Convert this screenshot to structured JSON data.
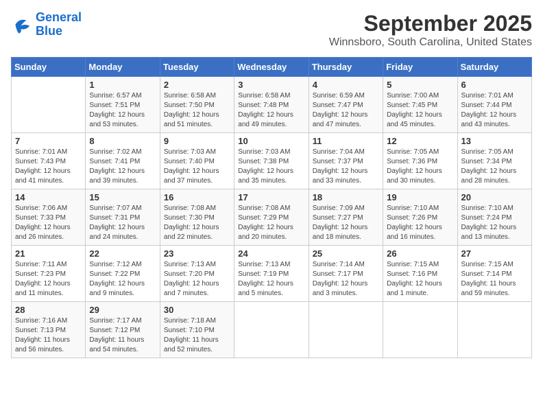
{
  "logo": {
    "line1": "General",
    "line2": "Blue"
  },
  "title": "September 2025",
  "location": "Winnsboro, South Carolina, United States",
  "days_of_week": [
    "Sunday",
    "Monday",
    "Tuesday",
    "Wednesday",
    "Thursday",
    "Friday",
    "Saturday"
  ],
  "weeks": [
    [
      {
        "day": "",
        "info": ""
      },
      {
        "day": "1",
        "info": "Sunrise: 6:57 AM\nSunset: 7:51 PM\nDaylight: 12 hours\nand 53 minutes."
      },
      {
        "day": "2",
        "info": "Sunrise: 6:58 AM\nSunset: 7:50 PM\nDaylight: 12 hours\nand 51 minutes."
      },
      {
        "day": "3",
        "info": "Sunrise: 6:58 AM\nSunset: 7:48 PM\nDaylight: 12 hours\nand 49 minutes."
      },
      {
        "day": "4",
        "info": "Sunrise: 6:59 AM\nSunset: 7:47 PM\nDaylight: 12 hours\nand 47 minutes."
      },
      {
        "day": "5",
        "info": "Sunrise: 7:00 AM\nSunset: 7:45 PM\nDaylight: 12 hours\nand 45 minutes."
      },
      {
        "day": "6",
        "info": "Sunrise: 7:01 AM\nSunset: 7:44 PM\nDaylight: 12 hours\nand 43 minutes."
      }
    ],
    [
      {
        "day": "7",
        "info": "Sunrise: 7:01 AM\nSunset: 7:43 PM\nDaylight: 12 hours\nand 41 minutes."
      },
      {
        "day": "8",
        "info": "Sunrise: 7:02 AM\nSunset: 7:41 PM\nDaylight: 12 hours\nand 39 minutes."
      },
      {
        "day": "9",
        "info": "Sunrise: 7:03 AM\nSunset: 7:40 PM\nDaylight: 12 hours\nand 37 minutes."
      },
      {
        "day": "10",
        "info": "Sunrise: 7:03 AM\nSunset: 7:38 PM\nDaylight: 12 hours\nand 35 minutes."
      },
      {
        "day": "11",
        "info": "Sunrise: 7:04 AM\nSunset: 7:37 PM\nDaylight: 12 hours\nand 33 minutes."
      },
      {
        "day": "12",
        "info": "Sunrise: 7:05 AM\nSunset: 7:36 PM\nDaylight: 12 hours\nand 30 minutes."
      },
      {
        "day": "13",
        "info": "Sunrise: 7:05 AM\nSunset: 7:34 PM\nDaylight: 12 hours\nand 28 minutes."
      }
    ],
    [
      {
        "day": "14",
        "info": "Sunrise: 7:06 AM\nSunset: 7:33 PM\nDaylight: 12 hours\nand 26 minutes."
      },
      {
        "day": "15",
        "info": "Sunrise: 7:07 AM\nSunset: 7:31 PM\nDaylight: 12 hours\nand 24 minutes."
      },
      {
        "day": "16",
        "info": "Sunrise: 7:08 AM\nSunset: 7:30 PM\nDaylight: 12 hours\nand 22 minutes."
      },
      {
        "day": "17",
        "info": "Sunrise: 7:08 AM\nSunset: 7:29 PM\nDaylight: 12 hours\nand 20 minutes."
      },
      {
        "day": "18",
        "info": "Sunrise: 7:09 AM\nSunset: 7:27 PM\nDaylight: 12 hours\nand 18 minutes."
      },
      {
        "day": "19",
        "info": "Sunrise: 7:10 AM\nSunset: 7:26 PM\nDaylight: 12 hours\nand 16 minutes."
      },
      {
        "day": "20",
        "info": "Sunrise: 7:10 AM\nSunset: 7:24 PM\nDaylight: 12 hours\nand 13 minutes."
      }
    ],
    [
      {
        "day": "21",
        "info": "Sunrise: 7:11 AM\nSunset: 7:23 PM\nDaylight: 12 hours\nand 11 minutes."
      },
      {
        "day": "22",
        "info": "Sunrise: 7:12 AM\nSunset: 7:22 PM\nDaylight: 12 hours\nand 9 minutes."
      },
      {
        "day": "23",
        "info": "Sunrise: 7:13 AM\nSunset: 7:20 PM\nDaylight: 12 hours\nand 7 minutes."
      },
      {
        "day": "24",
        "info": "Sunrise: 7:13 AM\nSunset: 7:19 PM\nDaylight: 12 hours\nand 5 minutes."
      },
      {
        "day": "25",
        "info": "Sunrise: 7:14 AM\nSunset: 7:17 PM\nDaylight: 12 hours\nand 3 minutes."
      },
      {
        "day": "26",
        "info": "Sunrise: 7:15 AM\nSunset: 7:16 PM\nDaylight: 12 hours\nand 1 minute."
      },
      {
        "day": "27",
        "info": "Sunrise: 7:15 AM\nSunset: 7:14 PM\nDaylight: 11 hours\nand 59 minutes."
      }
    ],
    [
      {
        "day": "28",
        "info": "Sunrise: 7:16 AM\nSunset: 7:13 PM\nDaylight: 11 hours\nand 56 minutes."
      },
      {
        "day": "29",
        "info": "Sunrise: 7:17 AM\nSunset: 7:12 PM\nDaylight: 11 hours\nand 54 minutes."
      },
      {
        "day": "30",
        "info": "Sunrise: 7:18 AM\nSunset: 7:10 PM\nDaylight: 11 hours\nand 52 minutes."
      },
      {
        "day": "",
        "info": ""
      },
      {
        "day": "",
        "info": ""
      },
      {
        "day": "",
        "info": ""
      },
      {
        "day": "",
        "info": ""
      }
    ]
  ]
}
